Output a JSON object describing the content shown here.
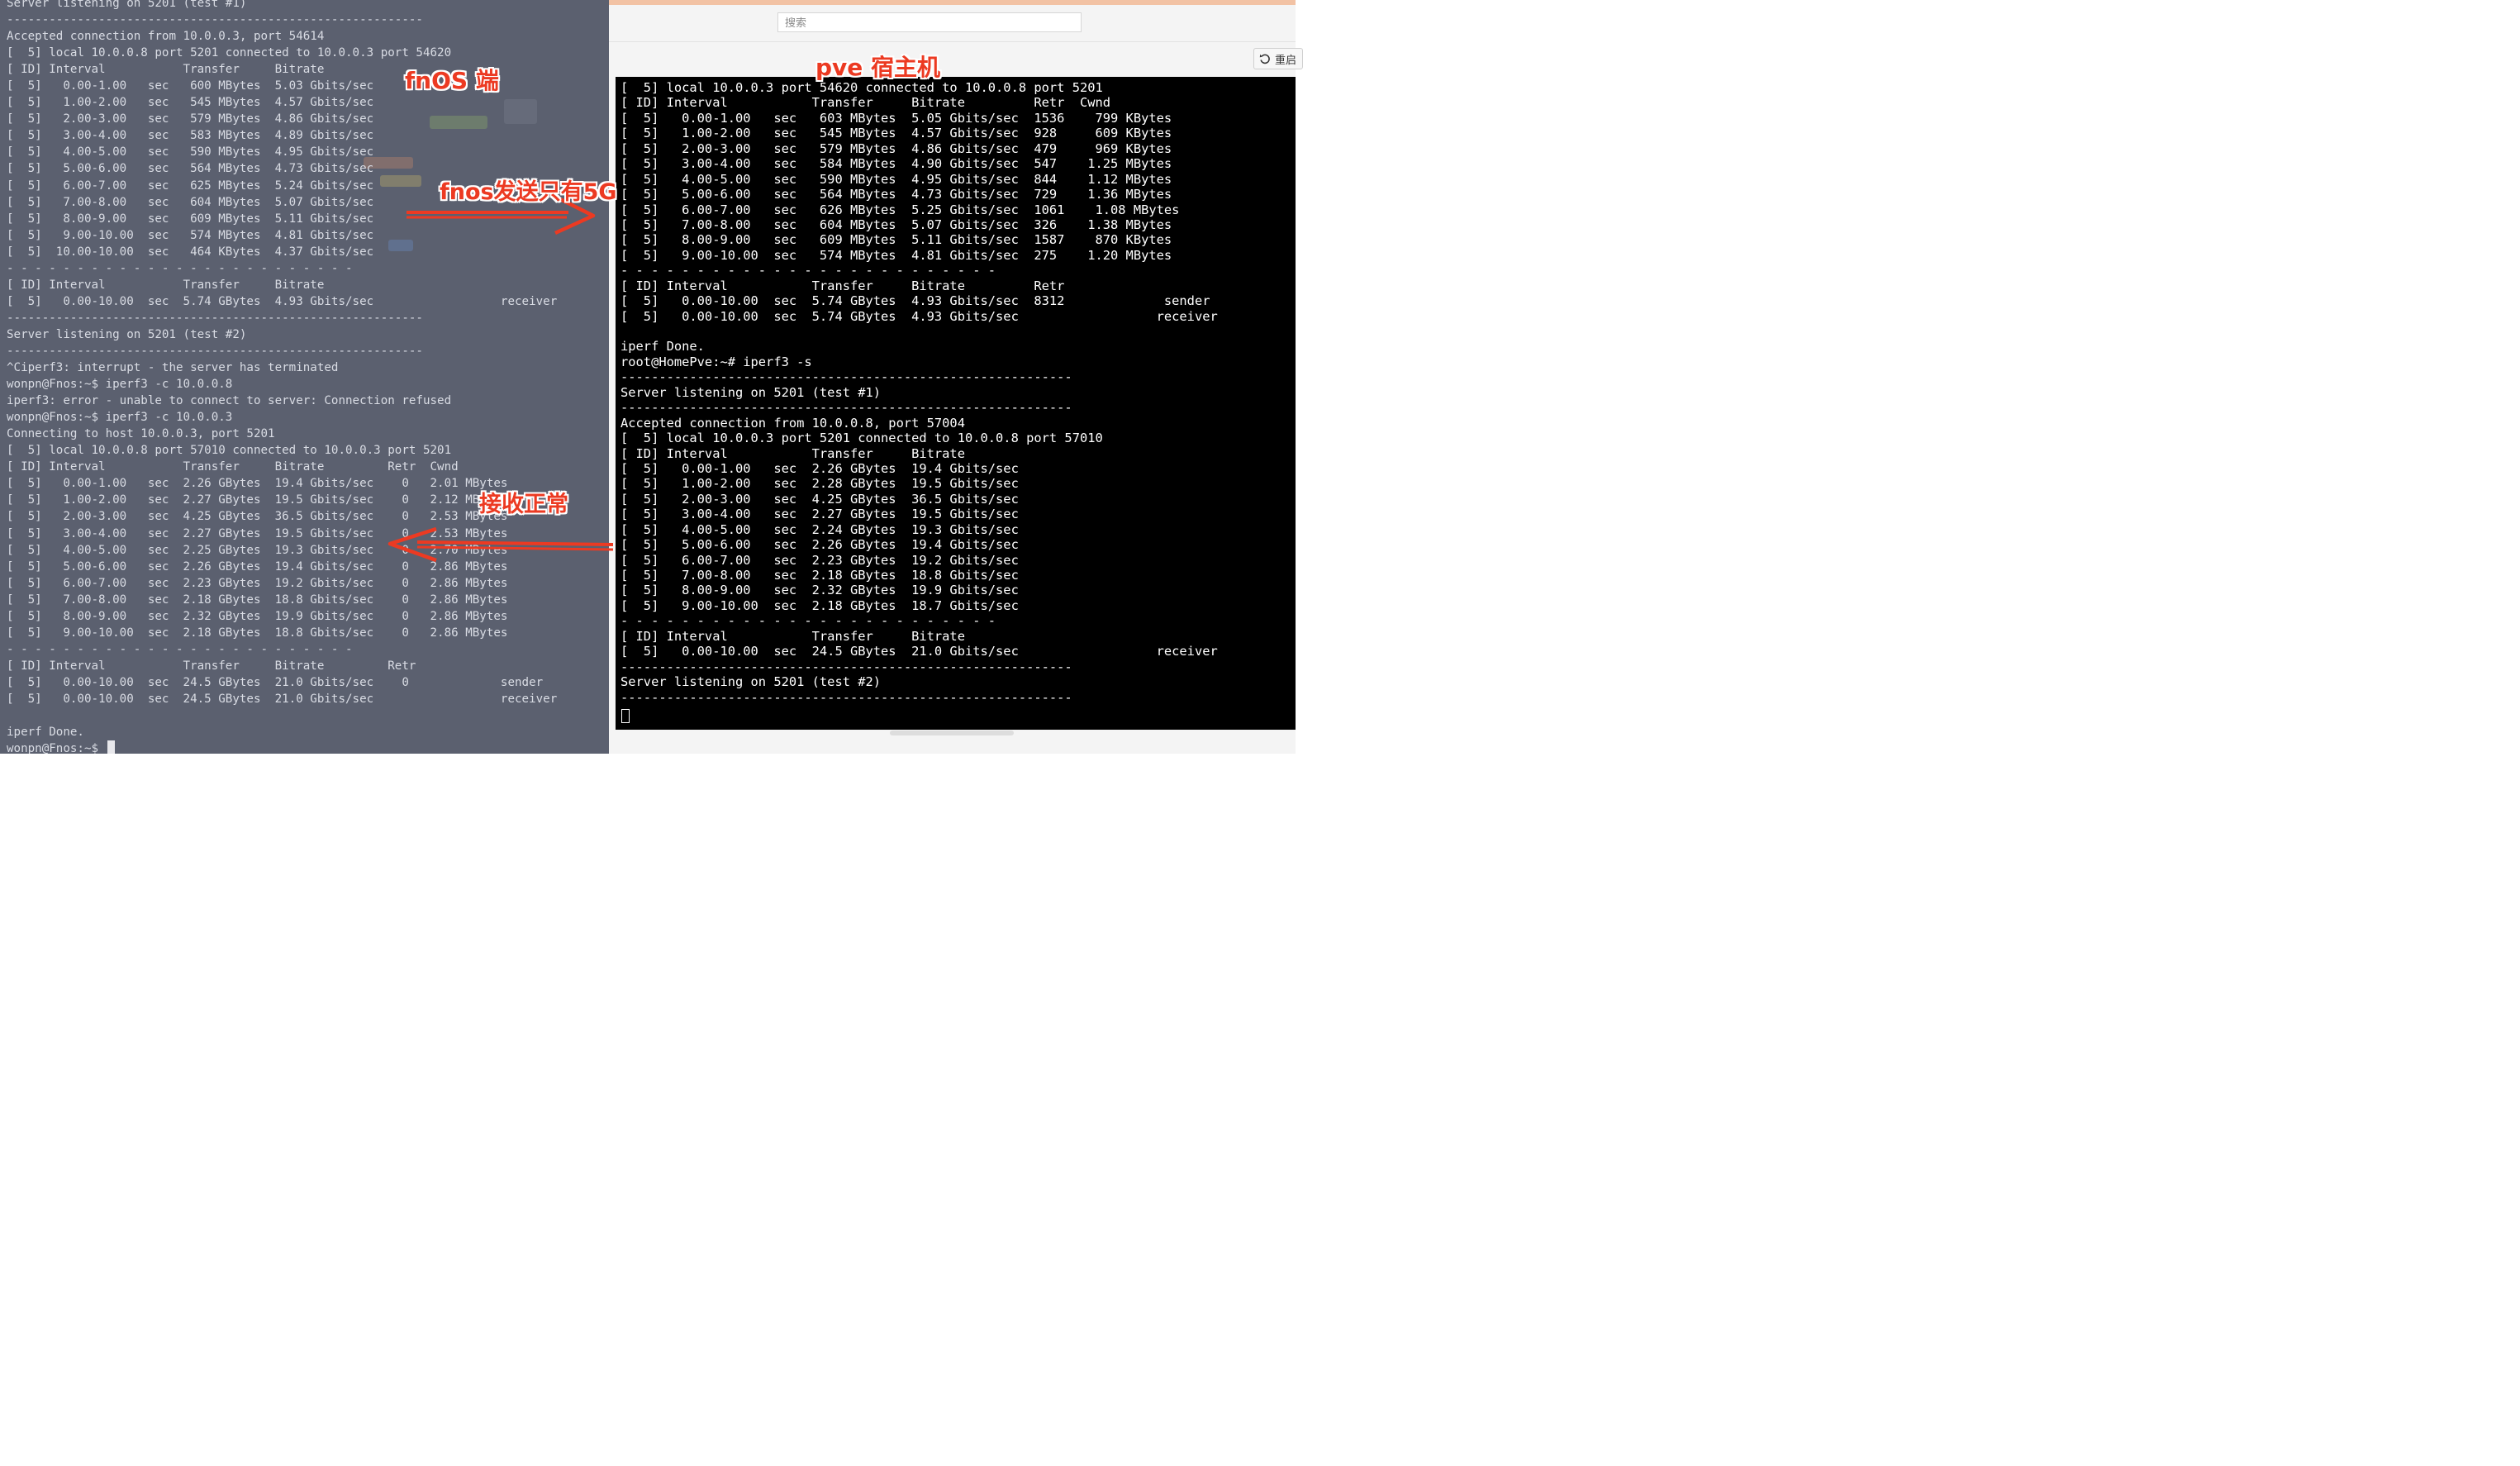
{
  "left_terminal": {
    "lines": [
      "Server listening on 5201 (test #1)",
      "-----------------------------------------------------------",
      "Accepted connection from 10.0.0.3, port 54614",
      "[  5] local 10.0.0.8 port 5201 connected to 10.0.0.3 port 54620",
      "[ ID] Interval           Transfer     Bitrate",
      "[  5]   0.00-1.00   sec   600 MBytes  5.03 Gbits/sec",
      "[  5]   1.00-2.00   sec   545 MBytes  4.57 Gbits/sec",
      "[  5]   2.00-3.00   sec   579 MBytes  4.86 Gbits/sec",
      "[  5]   3.00-4.00   sec   583 MBytes  4.89 Gbits/sec",
      "[  5]   4.00-5.00   sec   590 MBytes  4.95 Gbits/sec",
      "[  5]   5.00-6.00   sec   564 MBytes  4.73 Gbits/sec",
      "[  5]   6.00-7.00   sec   625 MBytes  5.24 Gbits/sec",
      "[  5]   7.00-8.00   sec   604 MBytes  5.07 Gbits/sec",
      "[  5]   8.00-9.00   sec   609 MBytes  5.11 Gbits/sec",
      "[  5]   9.00-10.00  sec   574 MBytes  4.81 Gbits/sec",
      "[  5]  10.00-10.00  sec   464 KBytes  4.37 Gbits/sec",
      "- - - - - - - - - - - - - - - - - - - - - - - - -",
      "[ ID] Interval           Transfer     Bitrate",
      "[  5]   0.00-10.00  sec  5.74 GBytes  4.93 Gbits/sec                  receiver",
      "-----------------------------------------------------------",
      "Server listening on 5201 (test #2)",
      "-----------------------------------------------------------",
      "^Ciperf3: interrupt - the server has terminated",
      "wonpn@Fnos:~$ iperf3 -c 10.0.0.8",
      "iperf3: error - unable to connect to server: Connection refused",
      "wonpn@Fnos:~$ iperf3 -c 10.0.0.3",
      "Connecting to host 10.0.0.3, port 5201",
      "[  5] local 10.0.0.8 port 57010 connected to 10.0.0.3 port 5201",
      "[ ID] Interval           Transfer     Bitrate         Retr  Cwnd",
      "[  5]   0.00-1.00   sec  2.26 GBytes  19.4 Gbits/sec    0   2.01 MBytes",
      "[  5]   1.00-2.00   sec  2.27 GBytes  19.5 Gbits/sec    0   2.12 MBytes",
      "[  5]   2.00-3.00   sec  4.25 GBytes  36.5 Gbits/sec    0   2.53 MBytes",
      "[  5]   3.00-4.00   sec  2.27 GBytes  19.5 Gbits/sec    0   2.53 MBytes",
      "[  5]   4.00-5.00   sec  2.25 GBytes  19.3 Gbits/sec    0   2.70 MBytes",
      "[  5]   5.00-6.00   sec  2.26 GBytes  19.4 Gbits/sec    0   2.86 MBytes",
      "[  5]   6.00-7.00   sec  2.23 GBytes  19.2 Gbits/sec    0   2.86 MBytes",
      "[  5]   7.00-8.00   sec  2.18 GBytes  18.8 Gbits/sec    0   2.86 MBytes",
      "[  5]   8.00-9.00   sec  2.32 GBytes  19.9 Gbits/sec    0   2.86 MBytes",
      "[  5]   9.00-10.00  sec  2.18 GBytes  18.8 Gbits/sec    0   2.86 MBytes",
      "- - - - - - - - - - - - - - - - - - - - - - - - -",
      "[ ID] Interval           Transfer     Bitrate         Retr",
      "[  5]   0.00-10.00  sec  24.5 GBytes  21.0 Gbits/sec    0             sender",
      "[  5]   0.00-10.00  sec  24.5 GBytes  21.0 Gbits/sec                  receiver",
      "",
      "iperf Done.",
      "wonpn@Fnos:~$ "
    ]
  },
  "right_panel": {
    "search_placeholder": "搜索",
    "restart_label": "重启",
    "console_lines": [
      "[  5] local 10.0.0.3 port 54620 connected to 10.0.0.8 port 5201",
      "[ ID] Interval           Transfer     Bitrate         Retr  Cwnd",
      "[  5]   0.00-1.00   sec   603 MBytes  5.05 Gbits/sec  1536    799 KBytes",
      "[  5]   1.00-2.00   sec   545 MBytes  4.57 Gbits/sec  928     609 KBytes",
      "[  5]   2.00-3.00   sec   579 MBytes  4.86 Gbits/sec  479     969 KBytes",
      "[  5]   3.00-4.00   sec   584 MBytes  4.90 Gbits/sec  547    1.25 MBytes",
      "[  5]   4.00-5.00   sec   590 MBytes  4.95 Gbits/sec  844    1.12 MBytes",
      "[  5]   5.00-6.00   sec   564 MBytes  4.73 Gbits/sec  729    1.36 MBytes",
      "[  5]   6.00-7.00   sec   626 MBytes  5.25 Gbits/sec  1061    1.08 MBytes",
      "[  5]   7.00-8.00   sec   604 MBytes  5.07 Gbits/sec  326    1.38 MBytes",
      "[  5]   8.00-9.00   sec   609 MBytes  5.11 Gbits/sec  1587    870 KBytes",
      "[  5]   9.00-10.00  sec   574 MBytes  4.81 Gbits/sec  275    1.20 MBytes",
      "- - - - - - - - - - - - - - - - - - - - - - - - -",
      "[ ID] Interval           Transfer     Bitrate         Retr",
      "[  5]   0.00-10.00  sec  5.74 GBytes  4.93 Gbits/sec  8312             sender",
      "[  5]   0.00-10.00  sec  5.74 GBytes  4.93 Gbits/sec                  receiver",
      "",
      "iperf Done.",
      "root@HomePve:~# iperf3 -s",
      "-----------------------------------------------------------",
      "Server listening on 5201 (test #1)",
      "-----------------------------------------------------------",
      "Accepted connection from 10.0.0.8, port 57004",
      "[  5] local 10.0.0.3 port 5201 connected to 10.0.0.8 port 57010",
      "[ ID] Interval           Transfer     Bitrate",
      "[  5]   0.00-1.00   sec  2.26 GBytes  19.4 Gbits/sec",
      "[  5]   1.00-2.00   sec  2.28 GBytes  19.5 Gbits/sec",
      "[  5]   2.00-3.00   sec  4.25 GBytes  36.5 Gbits/sec",
      "[  5]   3.00-4.00   sec  2.27 GBytes  19.5 Gbits/sec",
      "[  5]   4.00-5.00   sec  2.24 GBytes  19.3 Gbits/sec",
      "[  5]   5.00-6.00   sec  2.26 GBytes  19.4 Gbits/sec",
      "[  5]   6.00-7.00   sec  2.23 GBytes  19.2 Gbits/sec",
      "[  5]   7.00-8.00   sec  2.18 GBytes  18.8 Gbits/sec",
      "[  5]   8.00-9.00   sec  2.32 GBytes  19.9 Gbits/sec",
      "[  5]   9.00-10.00  sec  2.18 GBytes  18.7 Gbits/sec",
      "- - - - - - - - - - - - - - - - - - - - - - - - -",
      "[ ID] Interval           Transfer     Bitrate",
      "[  5]   0.00-10.00  sec  24.5 GBytes  21.0 Gbits/sec                  receiver",
      "-----------------------------------------------------------",
      "Server listening on 5201 (test #2)",
      "-----------------------------------------------------------"
    ]
  },
  "annotations": {
    "fnos_label": "fnOS 端",
    "pve_label": "pve 宿主机",
    "send_note": "fnos发送只有5G",
    "receive_note": "接收正常"
  },
  "colors": {
    "annotation": "#ec3a22",
    "left_terminal_bg": "#5b606f",
    "console_bg": "#000000"
  }
}
